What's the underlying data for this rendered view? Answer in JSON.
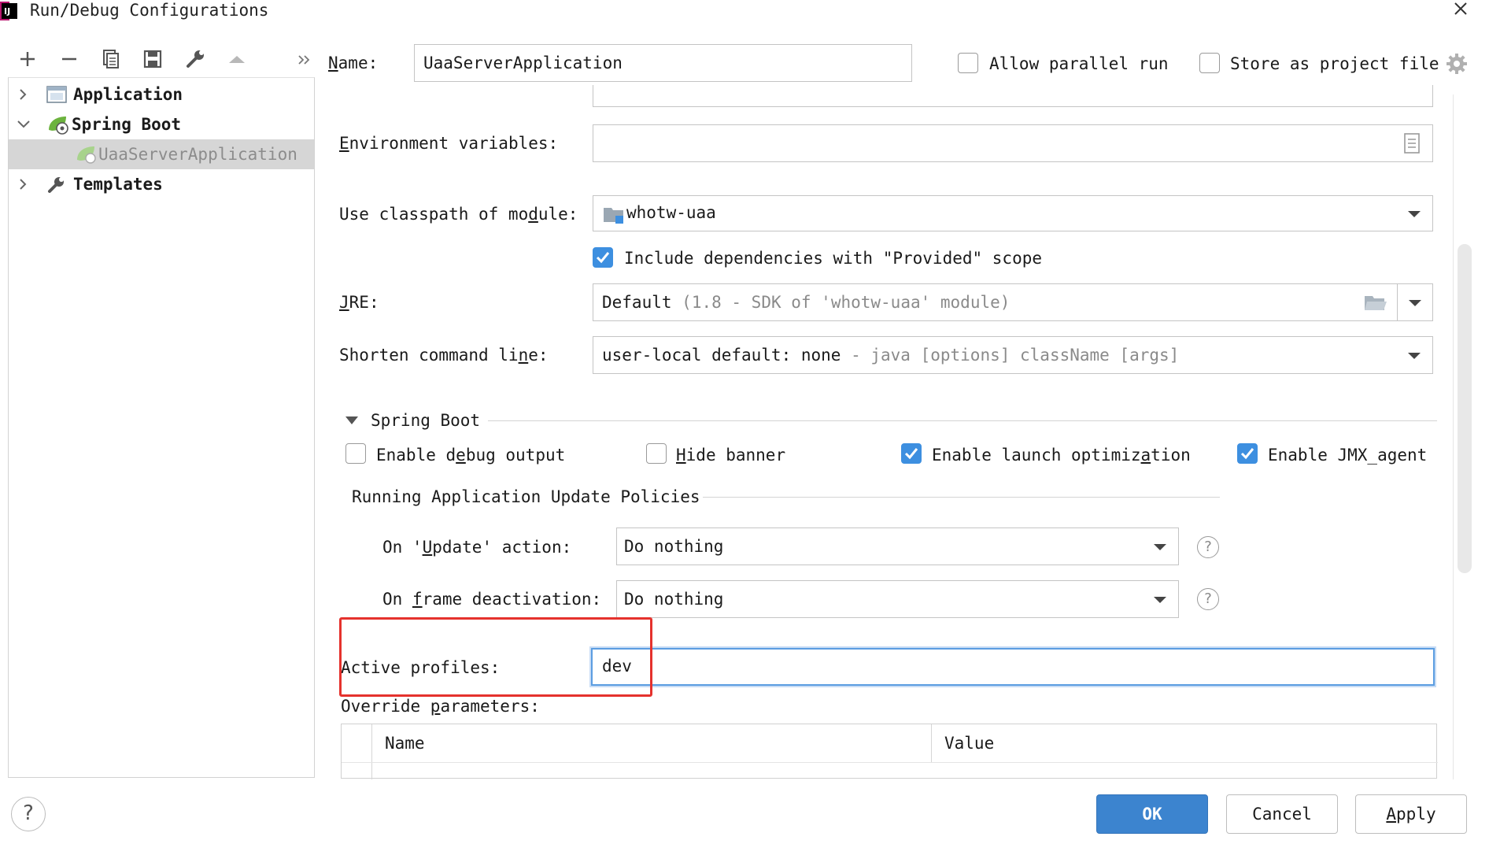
{
  "window": {
    "title": "Run/Debug Configurations"
  },
  "toolbar": {
    "icons": [
      "plus-icon",
      "minus-icon",
      "copy-icon",
      "save-icon",
      "wrench-icon",
      "arrow-up-icon",
      "double-chevron-right-icon"
    ]
  },
  "header": {
    "name_label": "Name:",
    "name_value": "UaaServerApplication",
    "allow_parallel_label": "Allow parallel run",
    "allow_parallel_checked": false,
    "store_project_label": "Store as project file",
    "store_project_checked": false
  },
  "tree": {
    "items": [
      {
        "label": "Application",
        "expanded": false
      },
      {
        "label": "Spring Boot",
        "expanded": true
      },
      {
        "label": "UaaServerApplication",
        "selected": true
      },
      {
        "label": "Templates",
        "expanded": false
      }
    ]
  },
  "form": {
    "env_label": "Environment variables:",
    "env_value": "",
    "classpath_label": "Use classpath of module:",
    "classpath_value": "whotw-uaa",
    "include_deps_label": "Include dependencies with \"Provided\" scope",
    "include_deps_checked": true,
    "jre_label": "JRE:",
    "jre_value": "Default",
    "jre_hint": "(1.8 - SDK of 'whotw-uaa' module)",
    "shorten_label": "Shorten command line:",
    "shorten_value": "user-local default: none",
    "shorten_hint": "- java [options] className [args]"
  },
  "spring_boot": {
    "section_title": "Spring Boot",
    "debug_label": "Enable debug output",
    "debug_checked": false,
    "hide_banner_label": "Hide banner",
    "hide_banner_checked": false,
    "launch_opt_label": "Enable launch optimization",
    "launch_opt_checked": true,
    "jmx_label": "Enable JMX agent",
    "jmx_checked": true,
    "policies_title": "Running Application Update Policies",
    "update_action_label": "On 'Update' action:",
    "update_action_value": "Do nothing",
    "frame_deact_label": "On frame deactivation:",
    "frame_deact_value": "Do nothing",
    "help_glyph": "?",
    "active_profiles_label": "Active profiles:",
    "active_profiles_value": "dev",
    "override_label": "Override parameters:",
    "table_columns": [
      "Name",
      "Value"
    ]
  },
  "footer": {
    "help_glyph": "?",
    "ok_label": "OK",
    "cancel_label": "Cancel",
    "apply_label": "Apply"
  },
  "colors": {
    "accent": "#3c84cf",
    "checkbox_checked": "#3d8fe0",
    "highlight_box": "#e5322d",
    "selection": "#d6d6d6"
  }
}
